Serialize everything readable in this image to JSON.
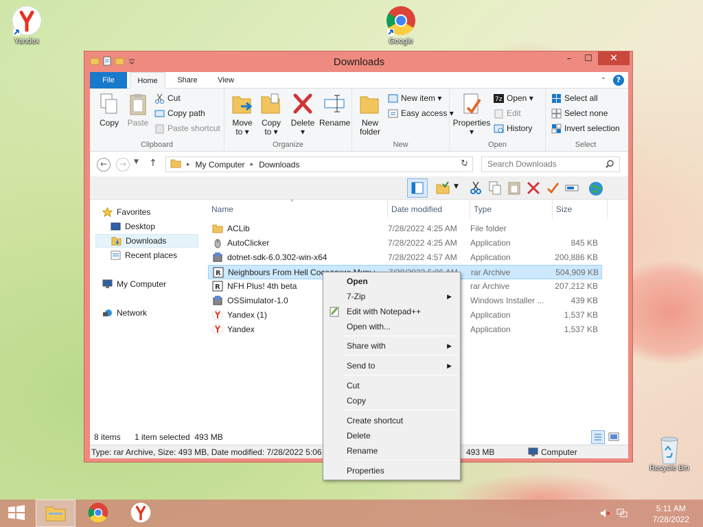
{
  "desktop": {
    "icons": [
      {
        "label": "Yandex"
      },
      {
        "label": "Google"
      },
      {
        "label": "Recycle Bin"
      }
    ]
  },
  "window": {
    "title": "Downloads",
    "buttons": {
      "minimize": "–",
      "maximize": "☐",
      "close": "✕"
    }
  },
  "ribbon_tabs": [
    "File",
    "Home",
    "Share",
    "View"
  ],
  "ribbon": {
    "clipboard": {
      "label": "Clipboard",
      "copy": "Copy",
      "paste": "Paste",
      "cut": "Cut",
      "copy_path": "Copy path",
      "paste_shortcut": "Paste shortcut"
    },
    "organize": {
      "label": "Organize",
      "move_to": "Move",
      "move_to2": "to ▾",
      "copy_to": "Copy",
      "copy_to2": "to ▾",
      "delete": "Delete",
      "delete2": "▾",
      "rename": "Rename"
    },
    "new": {
      "label": "New",
      "new_folder": "New",
      "new_folder2": "folder",
      "new_item": "New item ▾",
      "easy_access": "Easy access ▾"
    },
    "open": {
      "label": "Open",
      "properties": "Properties",
      "properties2": "▾",
      "open": "Open ▾",
      "edit": "Edit",
      "history": "History"
    },
    "select": {
      "label": "Select",
      "select_all": "Select all",
      "select_none": "Select none",
      "invert": "Invert selection"
    }
  },
  "address": {
    "path": [
      "My Computer",
      "Downloads"
    ],
    "search_placeholder": "Search Downloads"
  },
  "nav": {
    "favorites": "Favorites",
    "desktop": "Desktop",
    "downloads": "Downloads",
    "recent": "Recent places",
    "computer": "My Computer",
    "network": "Network"
  },
  "columns": {
    "name": "Name",
    "date": "Date modified",
    "type": "Type",
    "size": "Size"
  },
  "files": [
    {
      "name": "ACLib",
      "date": "7/28/2022 4:25 AM",
      "type": "File folder",
      "size": ""
    },
    {
      "name": "AutoClicker",
      "date": "7/28/2022 4:25 AM",
      "type": "Application",
      "size": "845 KB"
    },
    {
      "name": "dotnet-sdk-6.0.302-win-x64",
      "date": "7/28/2022 4:57 AM",
      "type": "Application",
      "size": "200,886 KB"
    },
    {
      "name": "Neighbours From Hell Соседские Миры",
      "date": "7/28/2022 5:06 AM",
      "type": "rar Archive",
      "size": "504,909 KB"
    },
    {
      "name": "NFH Plus! 4th beta",
      "date": "",
      "type": "rar Archive",
      "size": "207,212 KB"
    },
    {
      "name": "OSSimulator-1.0",
      "date": "",
      "type": "Windows Installer ...",
      "size": "439 KB"
    },
    {
      "name": "Yandex (1)",
      "date": "",
      "type": "Application",
      "size": "1,537 KB"
    },
    {
      "name": "Yandex",
      "date": "",
      "type": "Application",
      "size": "1,537 KB"
    }
  ],
  "status": {
    "count": "8 items",
    "selected": "1 item selected  493 MB",
    "details": "Type: rar Archive, Size: 493 MB, Date modified: 7/28/2022 5:06 AM",
    "size": "493 MB",
    "location": "Computer"
  },
  "context_menu": {
    "open": "Open",
    "zip": "7-Zip",
    "notepad": "Edit with Notepad++",
    "open_with": "Open with...",
    "share_with": "Share with",
    "send_to": "Send to",
    "cut": "Cut",
    "copy": "Copy",
    "create_shortcut": "Create shortcut",
    "delete": "Delete",
    "rename": "Rename",
    "properties": "Properties"
  },
  "taskbar": {
    "time": "5:11 AM",
    "date": "7/28/2022"
  },
  "colors": {
    "titlebar": "#ee8a7f",
    "file_tab": "#1979ca",
    "close_button": "#c9483c",
    "selection": "#cce8ff"
  }
}
